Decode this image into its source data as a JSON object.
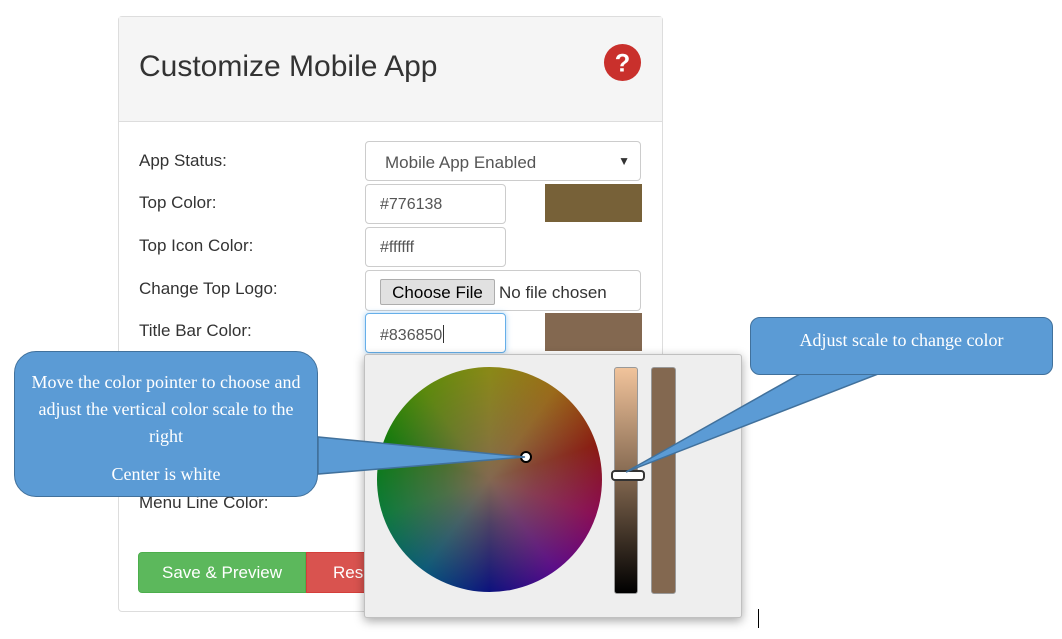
{
  "panel": {
    "title": "Customize Mobile App",
    "help_icon": "question-circle-icon"
  },
  "form": {
    "app_status": {
      "label": "App Status:",
      "value": "Mobile App Enabled"
    },
    "top_color": {
      "label": "Top Color:",
      "value": "#776138",
      "swatch": "#776138"
    },
    "top_icon_color": {
      "label": "Top Icon Color:",
      "value": "#ffffff"
    },
    "top_logo": {
      "label": "Change Top Logo:",
      "button": "Choose File",
      "status": "No file chosen"
    },
    "title_bar_color": {
      "label": "Title Bar Color:",
      "value": "#836850",
      "swatch": "#836850"
    },
    "menu_line_color": {
      "label": "Menu Line Color:"
    }
  },
  "buttons": {
    "save": "Save & Preview",
    "reset": "Res"
  },
  "picker": {
    "current_color": "#836850"
  },
  "callouts": {
    "left_main": "Move the color pointer to choose and adjust the vertical color scale to the right",
    "left_sub": "Center is white",
    "right": "Adjust scale to change color"
  },
  "colors": {
    "save": "#5cb85c",
    "reset": "#d9534f",
    "help": "#c9302c",
    "callout": "#5b9bd5"
  }
}
